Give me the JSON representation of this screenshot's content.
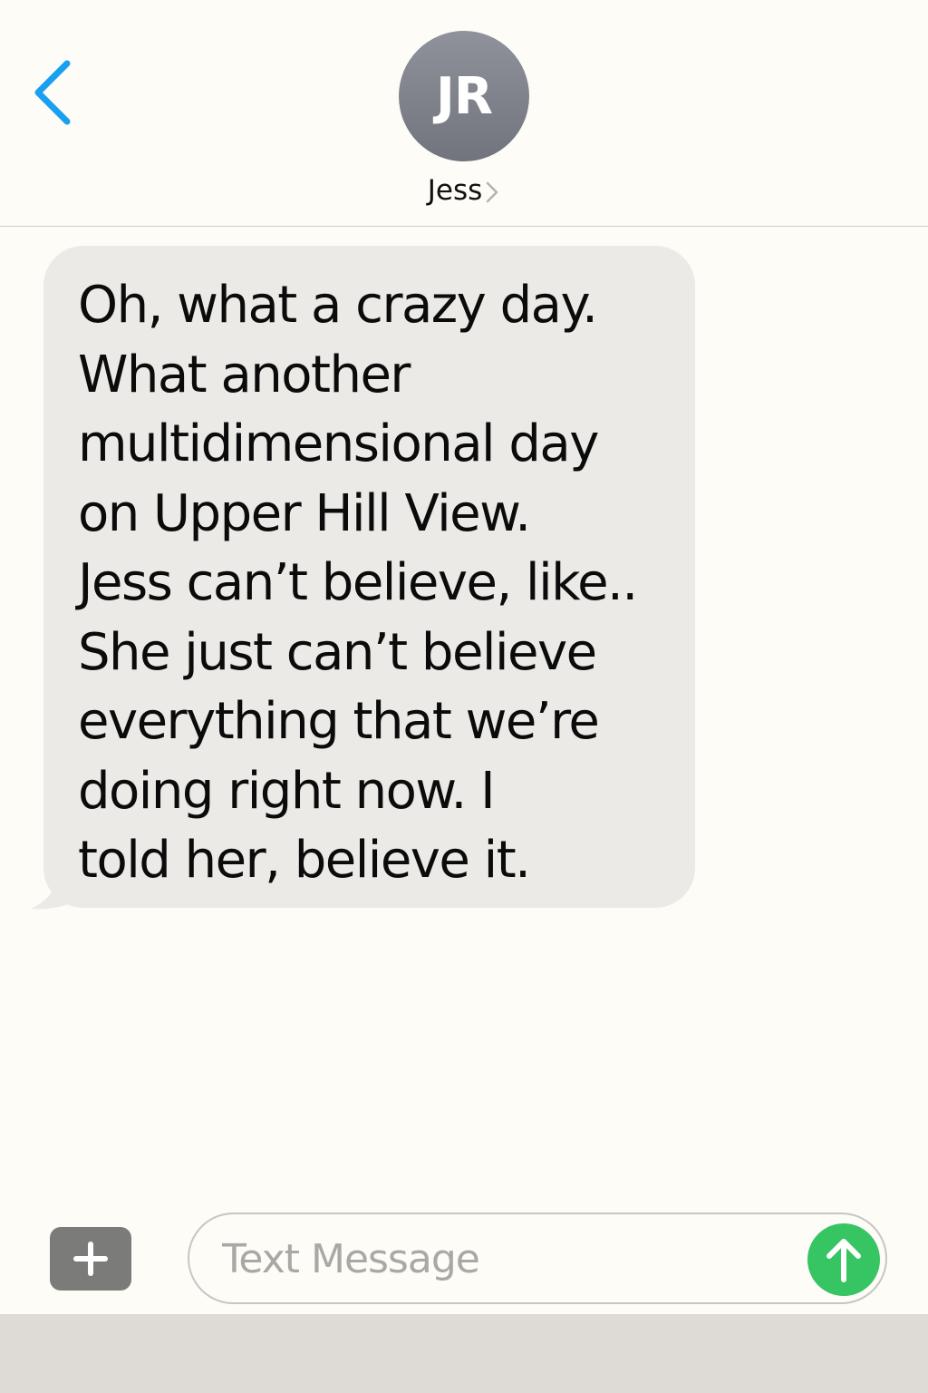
{
  "header": {
    "back_icon": "chevron-left-icon",
    "avatar_initials": "JR",
    "contact_name": "Jess",
    "contact_chevron_icon": "chevron-right-icon"
  },
  "conversation": {
    "messages": [
      {
        "direction": "incoming",
        "text": "Oh, what a crazy day.\nWhat another\nmultidimensional day\non Upper Hill View.\nJess can’t believe, like..\nShe just can’t believe\neverything that we’re\ndoing right now. I\ntold her, believe it."
      }
    ]
  },
  "composer": {
    "plus_icon": "plus-icon",
    "input_placeholder": "Text Message",
    "input_value": "",
    "send_icon": "arrow-up-icon"
  },
  "colors": {
    "background": "#fdfcf6",
    "accent_blue": "#1aa0f0",
    "incoming_bubble": "#ebeae6",
    "avatar": "#80838b",
    "send_green": "#37c463",
    "plus_button": "#7b7b7a",
    "bottom_bar": "#dedad6"
  }
}
